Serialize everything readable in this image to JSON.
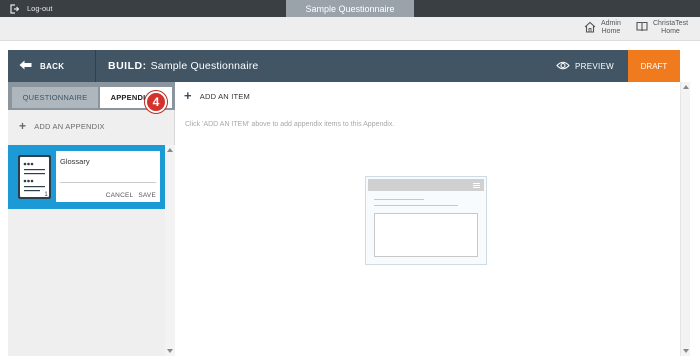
{
  "topbar": {
    "logout_label": "Log-out",
    "questionnaire_tab": "Sample Questionnaire"
  },
  "userbar": {
    "admin_home_line1": "Admin",
    "admin_home_line2": "Home",
    "user_home_line1": "ChristaTest",
    "user_home_line2": "Home"
  },
  "build": {
    "back_label": "BACK",
    "title_prefix": "BUILD:",
    "title": "Sample Questionnaire",
    "preview_label": "PREVIEW",
    "status_badge": "DRAFT"
  },
  "sidebar": {
    "tabs": [
      {
        "label": "QUESTIONNAIRE",
        "active": false
      },
      {
        "label": "APPENDICES",
        "active": true
      }
    ],
    "add_appendix_label": "ADD AN APPENDIX",
    "appendix": {
      "name_value": "Glossary",
      "doc_number": "1",
      "cancel_label": "CANCEL",
      "save_label": "SAVE"
    },
    "step_badge": "4"
  },
  "main": {
    "add_item_label": "ADD AN ITEM",
    "hint": "Click 'ADD AN ITEM' above to add appendix items to this Appendix."
  },
  "colors": {
    "topbar": "#3a3f44",
    "build_header": "#415565",
    "draft": "#f07b1f",
    "appendix_selected": "#1b9ad6",
    "step_badge": "#d4322c"
  }
}
